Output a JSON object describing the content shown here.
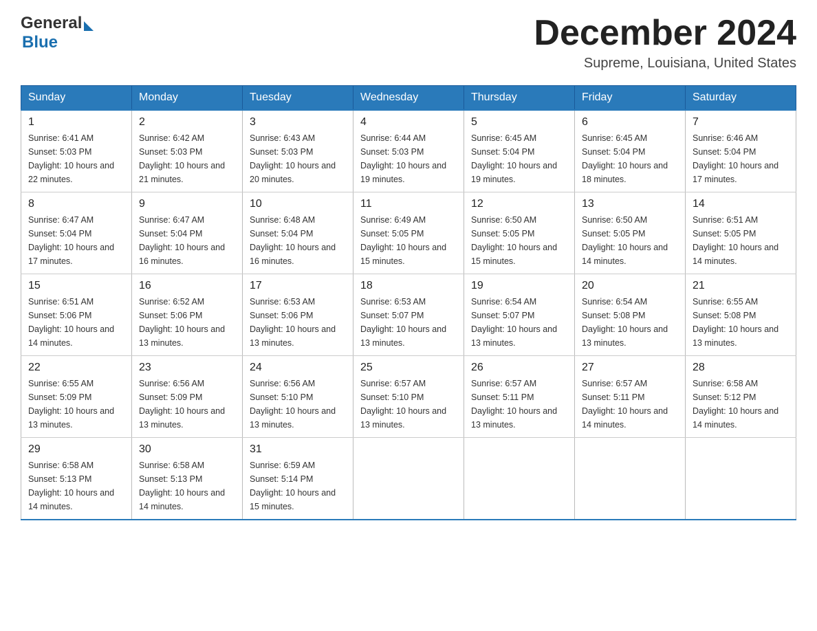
{
  "header": {
    "logo": {
      "line1": "General",
      "triangle": "▶",
      "line2": "Blue"
    },
    "title": "December 2024",
    "location": "Supreme, Louisiana, United States"
  },
  "weekdays": [
    "Sunday",
    "Monday",
    "Tuesday",
    "Wednesday",
    "Thursday",
    "Friday",
    "Saturday"
  ],
  "weeks": [
    [
      {
        "day": "1",
        "sunrise": "6:41 AM",
        "sunset": "5:03 PM",
        "daylight": "10 hours and 22 minutes."
      },
      {
        "day": "2",
        "sunrise": "6:42 AM",
        "sunset": "5:03 PM",
        "daylight": "10 hours and 21 minutes."
      },
      {
        "day": "3",
        "sunrise": "6:43 AM",
        "sunset": "5:03 PM",
        "daylight": "10 hours and 20 minutes."
      },
      {
        "day": "4",
        "sunrise": "6:44 AM",
        "sunset": "5:03 PM",
        "daylight": "10 hours and 19 minutes."
      },
      {
        "day": "5",
        "sunrise": "6:45 AM",
        "sunset": "5:04 PM",
        "daylight": "10 hours and 19 minutes."
      },
      {
        "day": "6",
        "sunrise": "6:45 AM",
        "sunset": "5:04 PM",
        "daylight": "10 hours and 18 minutes."
      },
      {
        "day": "7",
        "sunrise": "6:46 AM",
        "sunset": "5:04 PM",
        "daylight": "10 hours and 17 minutes."
      }
    ],
    [
      {
        "day": "8",
        "sunrise": "6:47 AM",
        "sunset": "5:04 PM",
        "daylight": "10 hours and 17 minutes."
      },
      {
        "day": "9",
        "sunrise": "6:47 AM",
        "sunset": "5:04 PM",
        "daylight": "10 hours and 16 minutes."
      },
      {
        "day": "10",
        "sunrise": "6:48 AM",
        "sunset": "5:04 PM",
        "daylight": "10 hours and 16 minutes."
      },
      {
        "day": "11",
        "sunrise": "6:49 AM",
        "sunset": "5:05 PM",
        "daylight": "10 hours and 15 minutes."
      },
      {
        "day": "12",
        "sunrise": "6:50 AM",
        "sunset": "5:05 PM",
        "daylight": "10 hours and 15 minutes."
      },
      {
        "day": "13",
        "sunrise": "6:50 AM",
        "sunset": "5:05 PM",
        "daylight": "10 hours and 14 minutes."
      },
      {
        "day": "14",
        "sunrise": "6:51 AM",
        "sunset": "5:05 PM",
        "daylight": "10 hours and 14 minutes."
      }
    ],
    [
      {
        "day": "15",
        "sunrise": "6:51 AM",
        "sunset": "5:06 PM",
        "daylight": "10 hours and 14 minutes."
      },
      {
        "day": "16",
        "sunrise": "6:52 AM",
        "sunset": "5:06 PM",
        "daylight": "10 hours and 13 minutes."
      },
      {
        "day": "17",
        "sunrise": "6:53 AM",
        "sunset": "5:06 PM",
        "daylight": "10 hours and 13 minutes."
      },
      {
        "day": "18",
        "sunrise": "6:53 AM",
        "sunset": "5:07 PM",
        "daylight": "10 hours and 13 minutes."
      },
      {
        "day": "19",
        "sunrise": "6:54 AM",
        "sunset": "5:07 PM",
        "daylight": "10 hours and 13 minutes."
      },
      {
        "day": "20",
        "sunrise": "6:54 AM",
        "sunset": "5:08 PM",
        "daylight": "10 hours and 13 minutes."
      },
      {
        "day": "21",
        "sunrise": "6:55 AM",
        "sunset": "5:08 PM",
        "daylight": "10 hours and 13 minutes."
      }
    ],
    [
      {
        "day": "22",
        "sunrise": "6:55 AM",
        "sunset": "5:09 PM",
        "daylight": "10 hours and 13 minutes."
      },
      {
        "day": "23",
        "sunrise": "6:56 AM",
        "sunset": "5:09 PM",
        "daylight": "10 hours and 13 minutes."
      },
      {
        "day": "24",
        "sunrise": "6:56 AM",
        "sunset": "5:10 PM",
        "daylight": "10 hours and 13 minutes."
      },
      {
        "day": "25",
        "sunrise": "6:57 AM",
        "sunset": "5:10 PM",
        "daylight": "10 hours and 13 minutes."
      },
      {
        "day": "26",
        "sunrise": "6:57 AM",
        "sunset": "5:11 PM",
        "daylight": "10 hours and 13 minutes."
      },
      {
        "day": "27",
        "sunrise": "6:57 AM",
        "sunset": "5:11 PM",
        "daylight": "10 hours and 14 minutes."
      },
      {
        "day": "28",
        "sunrise": "6:58 AM",
        "sunset": "5:12 PM",
        "daylight": "10 hours and 14 minutes."
      }
    ],
    [
      {
        "day": "29",
        "sunrise": "6:58 AM",
        "sunset": "5:13 PM",
        "daylight": "10 hours and 14 minutes."
      },
      {
        "day": "30",
        "sunrise": "6:58 AM",
        "sunset": "5:13 PM",
        "daylight": "10 hours and 14 minutes."
      },
      {
        "day": "31",
        "sunrise": "6:59 AM",
        "sunset": "5:14 PM",
        "daylight": "10 hours and 15 minutes."
      },
      null,
      null,
      null,
      null
    ]
  ]
}
